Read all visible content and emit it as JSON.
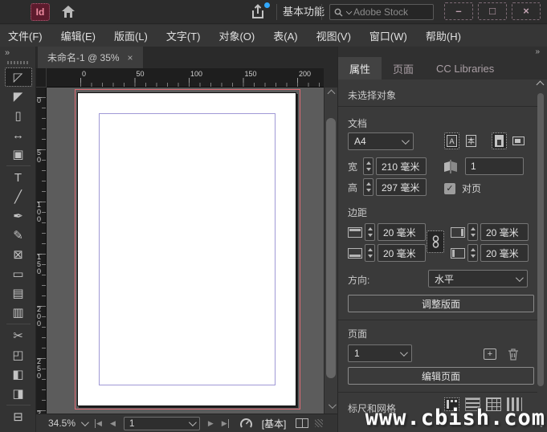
{
  "titlebar": {
    "logo": "Id",
    "workspace": "基本功能",
    "search_placeholder": "Adobe Stock",
    "win_min": "–",
    "win_max": "□",
    "win_close": "×"
  },
  "menus": [
    "文件(F)",
    "编辑(E)",
    "版面(L)",
    "文字(T)",
    "对象(O)",
    "表(A)",
    "视图(V)",
    "窗口(W)",
    "帮助(H)"
  ],
  "doc_tab": {
    "title": "未命名-1 @ 35%",
    "close": "×"
  },
  "toolbar": {
    "expand_icon": "»",
    "separators_after": [
      4,
      12,
      16
    ],
    "tools": [
      {
        "name": "selection-tool",
        "glyph": "◸",
        "active": true
      },
      {
        "name": "direct-selection-tool",
        "glyph": "◤"
      },
      {
        "name": "page-tool",
        "glyph": "▯"
      },
      {
        "name": "gap-tool",
        "glyph": "↔"
      },
      {
        "name": "content-collector-tool",
        "glyph": "▣"
      },
      {
        "name": "type-tool",
        "glyph": "T"
      },
      {
        "name": "line-tool",
        "glyph": "╱"
      },
      {
        "name": "pen-tool",
        "glyph": "✒"
      },
      {
        "name": "pencil-tool",
        "glyph": "✎"
      },
      {
        "name": "frame-tool",
        "glyph": "⊠"
      },
      {
        "name": "rectangle-tool",
        "glyph": "▭"
      },
      {
        "name": "horizontal-grid-tool",
        "glyph": "▤"
      },
      {
        "name": "vertical-grid-tool",
        "glyph": "▥"
      },
      {
        "name": "scissors-tool",
        "glyph": "✂"
      },
      {
        "name": "free-transform-tool",
        "glyph": "◰"
      },
      {
        "name": "gradient-swatch-tool",
        "glyph": "◧"
      },
      {
        "name": "gradient-feather-tool",
        "glyph": "◨"
      },
      {
        "name": "note-tool",
        "glyph": "⊟"
      }
    ]
  },
  "rulers": {
    "horizontal": [
      "0",
      "50",
      "100",
      "150",
      "200"
    ],
    "vertical": [
      "0",
      "50",
      "100",
      "150",
      "200",
      "250",
      "3"
    ]
  },
  "statusbar": {
    "zoom": "34.5%",
    "nav_first": "◀",
    "nav_prev": "◀",
    "page": "1",
    "nav_next": "▶",
    "nav_last": "▶",
    "preflight_label": "[基本]"
  },
  "panel": {
    "collapse_icon": "»",
    "tabs": [
      "属性",
      "页面",
      "CC Libraries"
    ],
    "no_selection": "未选择对象",
    "document": {
      "label": "文档",
      "preset": "A4",
      "dir_horizontal_glyph": "A",
      "dir_vertical_glyph": "本",
      "width_label": "宽",
      "width_value": "210 毫米",
      "height_label": "高",
      "height_value": "297 毫米",
      "pages_count": "1",
      "facing_check": "✓",
      "facing_label": "对页"
    },
    "margins": {
      "label": "边距",
      "top": "20 毫米",
      "bottom": "20 毫米",
      "inside": "20 毫米",
      "outside": "20 毫米"
    },
    "direction": {
      "label": "方向:",
      "value": "水平"
    },
    "adjust_layout_button": "调整版面",
    "pages": {
      "label": "页面",
      "current": "1",
      "add": "+",
      "edit_button": "编辑页面"
    },
    "rulers_grids": {
      "label": "标尺和网格"
    }
  },
  "watermark": "www.cbish.com"
}
